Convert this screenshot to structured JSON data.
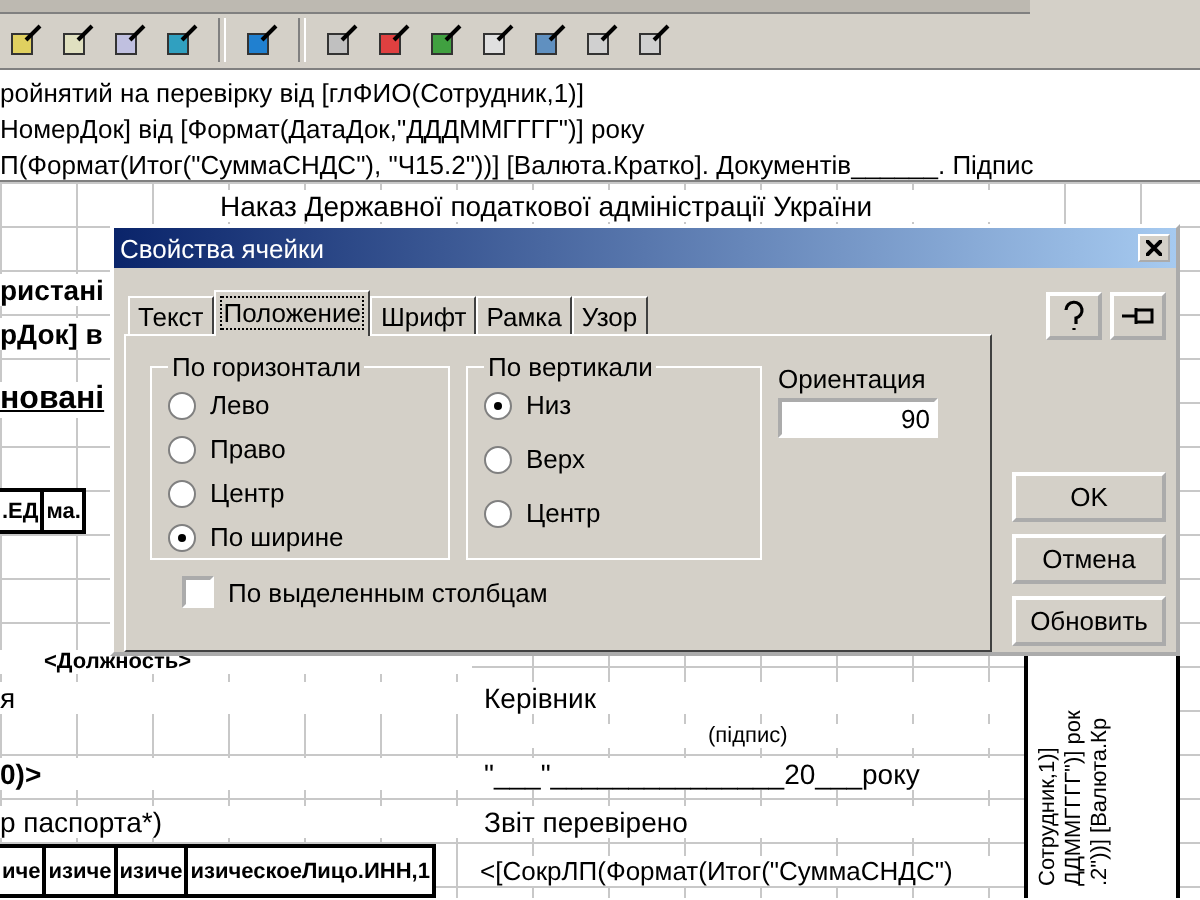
{
  "formula_lines": [
    "ройнятий на перевірку від [глФИО(Сотрудник,1)]",
    "НомерДок] від  [Формат(ДатаДок,\"ДДДММГГГГ\")] року",
    "П(Формат(Итог(\"СуммаСНДС\"), \"Ч15.2\"))] [Валюта.Кратко]. Документів______. Підпис"
  ],
  "sheet": {
    "title": "Наказ Державної податкової адміністрації України",
    "left": {
      "bold_1": "ристані",
      "bold_2": "рДок] в",
      "heading": "новані",
      "boxes_top": [
        ".ЕД",
        "ма."
      ],
      "position": "<Должность>",
      "line_1": "я",
      "line_2": "0)>",
      "line_3": "р паспорта*)",
      "boxes_bottom": [
        "иче",
        "изиче",
        "изиче",
        "изическоеЛицо.ИНН,1"
      ]
    },
    "right": {
      "head_label": "Керівник",
      "signature_hint": "(підпис)",
      "date_line": "\"___\"_______________20___року",
      "checked_label": "Звіт перевірено",
      "formula": "<[СокрЛП(Формат(Итог(\"СуммаСНДС\")"
    },
    "vertical_lines": [
      "Сотрудник,1)]",
      "ДДММГГГГ\")] рок",
      ".2\"))] [Валюта.Кр"
    ]
  },
  "dialog": {
    "title": "Свойства ячейки",
    "tabs": [
      {
        "label": "Текст",
        "selected": false
      },
      {
        "label": "Положение",
        "selected": true
      },
      {
        "label": "Шрифт",
        "selected": false
      },
      {
        "label": "Рамка",
        "selected": false
      },
      {
        "label": "Узор",
        "selected": false
      }
    ],
    "horizontal": {
      "title": "По горизонтали",
      "options": [
        {
          "label": "Лево",
          "selected": false
        },
        {
          "label": "Право",
          "selected": false
        },
        {
          "label": "Центр",
          "selected": false
        },
        {
          "label": "По ширине",
          "selected": true
        }
      ]
    },
    "vertical": {
      "title": "По вертикали",
      "options": [
        {
          "label": "Низ",
          "selected": true
        },
        {
          "label": "Верх",
          "selected": false
        },
        {
          "label": "Центр",
          "selected": false
        }
      ]
    },
    "orientation": {
      "label": "Ориентация",
      "value": "90"
    },
    "by_columns": {
      "label": "По выделенным столбцам",
      "checked": false
    },
    "buttons": [
      "OK",
      "Отмена",
      "Обновить"
    ]
  }
}
